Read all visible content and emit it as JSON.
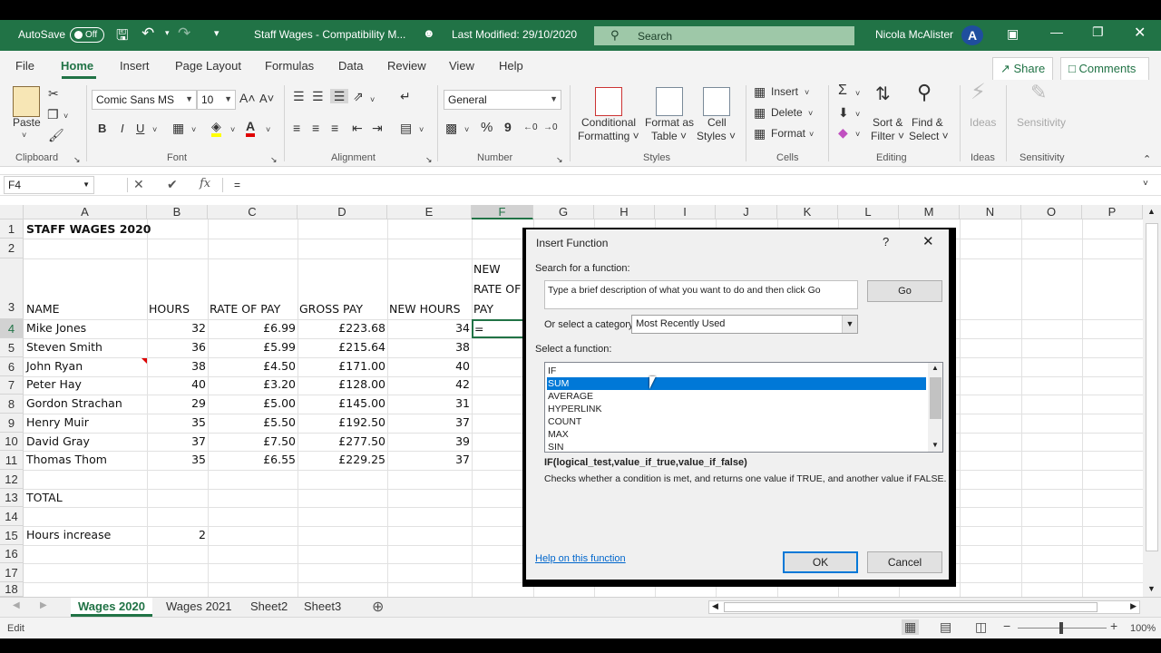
{
  "titlebar": {
    "autosave_label": "AutoSave",
    "autosave_state": "Off",
    "filename": "Staff Wages  -  Compatibility M...",
    "modified": "Last Modified: 29/10/2020",
    "search_placeholder": "Search",
    "user": "Nicola McAlister",
    "avatar_letter": "A"
  },
  "menu": {
    "items": [
      "File",
      "Home",
      "Insert",
      "Page Layout",
      "Formulas",
      "Data",
      "Review",
      "View",
      "Help"
    ],
    "share": "Share",
    "comments": "Comments"
  },
  "ribbon": {
    "clipboard": {
      "paste": "Paste",
      "label": "Clipboard"
    },
    "font": {
      "name": "Comic Sans MS",
      "size": "10",
      "bold": "B",
      "italic": "I",
      "underline": "U",
      "grow": "A˄",
      "shrink": "A˅",
      "label": "Font"
    },
    "alignment": {
      "label": "Alignment"
    },
    "number": {
      "format": "General",
      "percent": "%",
      "comma": "9",
      "label": "Number"
    },
    "styles": {
      "conditional": "Conditional",
      "conditional2": "Formatting ˅",
      "format_table": "Format as",
      "format_table2": "Table ˅",
      "cell_styles": "Cell",
      "cell_styles2": "Styles ˅",
      "label": "Styles"
    },
    "cells": {
      "insert": "Insert",
      "delete": "Delete",
      "format": "Format",
      "label": "Cells"
    },
    "editing": {
      "sort": "Sort &",
      "sort2": "Filter ˅",
      "find": "Find &",
      "find2": "Select ˅",
      "label": "Editing"
    },
    "ideas": {
      "ideas": "Ideas",
      "label": "Ideas"
    },
    "sensitivity": {
      "sensitivity": "Sensitivity",
      "label": "Sensitivity"
    }
  },
  "formula_bar": {
    "name_box": "F4",
    "cancel": "✕",
    "enter": "✔",
    "fx": "fx",
    "formula": "="
  },
  "columns": [
    "A",
    "B",
    "C",
    "D",
    "E",
    "F",
    "G",
    "H",
    "I",
    "J",
    "K",
    "L",
    "M",
    "N",
    "O",
    "P"
  ],
  "rows": [
    "1",
    "2",
    "3",
    "4",
    "5",
    "6",
    "7",
    "8",
    "9",
    "10",
    "11",
    "12",
    "13",
    "14",
    "15",
    "16",
    "17",
    "18"
  ],
  "sheet": {
    "title": "STAFF WAGES 2020",
    "headers": {
      "name": "NAME",
      "hours": "HOURS",
      "rate": "RATE OF PAY",
      "gross": "GROSS PAY",
      "new_hours": "NEW HOURS",
      "new_rate_1": "NEW",
      "new_rate_2": "RATE OF",
      "new_rate_3": "PAY"
    },
    "staff": [
      {
        "name": "Mike Jones",
        "hours": "32",
        "rate": "£6.99",
        "gross": "£223.68",
        "new_hours": "34"
      },
      {
        "name": "Steven Smith",
        "hours": "36",
        "rate": "£5.99",
        "gross": "£215.64",
        "new_hours": "38"
      },
      {
        "name": "John Ryan",
        "hours": "38",
        "rate": "£4.50",
        "gross": "£171.00",
        "new_hours": "40"
      },
      {
        "name": "Peter Hay",
        "hours": "40",
        "rate": "£3.20",
        "gross": "£128.00",
        "new_hours": "42"
      },
      {
        "name": "Gordon Strachan",
        "hours": "29",
        "rate": "£5.00",
        "gross": "£145.00",
        "new_hours": "31"
      },
      {
        "name": "Henry Muir",
        "hours": "35",
        "rate": "£5.50",
        "gross": "£192.50",
        "new_hours": "37"
      },
      {
        "name": "David Gray",
        "hours": "37",
        "rate": "£7.50",
        "gross": "£277.50",
        "new_hours": "39"
      },
      {
        "name": "Thomas Thom",
        "hours": "35",
        "rate": "£6.55",
        "gross": "£229.25",
        "new_hours": "37"
      }
    ],
    "active_value": "=",
    "total_label": "TOTAL",
    "hours_increase_label": "Hours increase",
    "hours_increase_value": "2"
  },
  "dialog": {
    "title": "Insert Function",
    "help": "?",
    "close": "✕",
    "search_label": "Search for a function:",
    "search_value": "Type a brief description of what you want to do and then click Go",
    "go": "Go",
    "category_label": "Or select a category:",
    "category_value": "Most Recently Used",
    "select_label": "Select a function:",
    "functions": [
      "IF",
      "SUM",
      "AVERAGE",
      "HYPERLINK",
      "COUNT",
      "MAX",
      "SIN"
    ],
    "selected_function": "SUM",
    "syntax": "IF(logical_test,value_if_true,value_if_false)",
    "description": "Checks whether a condition is met, and returns one value if TRUE, and another value if FALSE.",
    "help_link": "Help on this function",
    "ok": "OK",
    "cancel": "Cancel"
  },
  "tabs": [
    "Wages 2020",
    "Wages 2021",
    "Sheet2",
    "Sheet3"
  ],
  "active_tab": "Wages 2020",
  "status": {
    "mode": "Edit",
    "zoom": "100%"
  },
  "colors": {
    "excel_green": "#217346",
    "selection_blue": "#0078d7"
  }
}
